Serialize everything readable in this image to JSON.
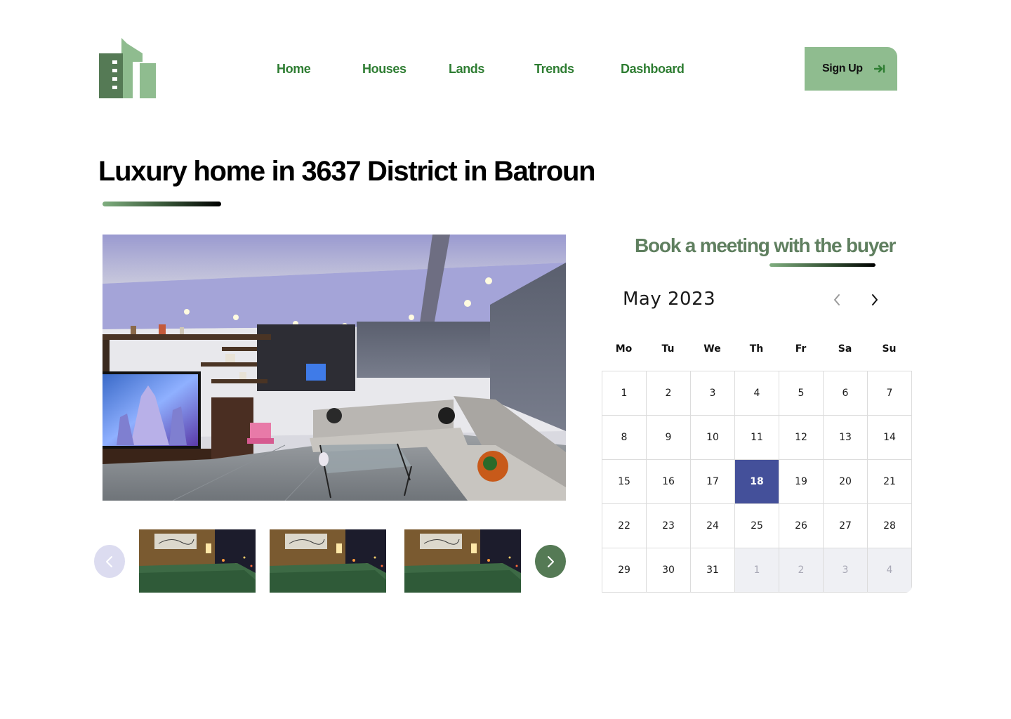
{
  "header": {
    "nav": [
      {
        "label": "Home"
      },
      {
        "label": "Houses"
      },
      {
        "label": "Lands"
      },
      {
        "label": "Trends"
      },
      {
        "label": "Dashboard"
      }
    ],
    "signup_label": "Sign Up"
  },
  "listing": {
    "title": "Luxury home in 3637 District in Batroun"
  },
  "booking": {
    "title": "Book a meeting with the buyer",
    "month_label": "May 2023",
    "weekdays": [
      "Mo",
      "Tu",
      "We",
      "Th",
      "Fr",
      "Sa",
      "Su"
    ],
    "days": [
      "1",
      "2",
      "3",
      "4",
      "5",
      "6",
      "7",
      "8",
      "9",
      "10",
      "11",
      "12",
      "13",
      "14",
      "15",
      "16",
      "17",
      "18",
      "19",
      "20",
      "21",
      "22",
      "23",
      "24",
      "25",
      "26",
      "27",
      "28",
      "29",
      "30",
      "31"
    ],
    "next_month_days": [
      "1",
      "2",
      "3",
      "4"
    ],
    "selected_day": "18"
  },
  "colors": {
    "brand_green": "#2e7d32",
    "signup_bg": "#8fbc8f",
    "selected_day": "#44509a",
    "heading_green": "#5f7f5f"
  }
}
